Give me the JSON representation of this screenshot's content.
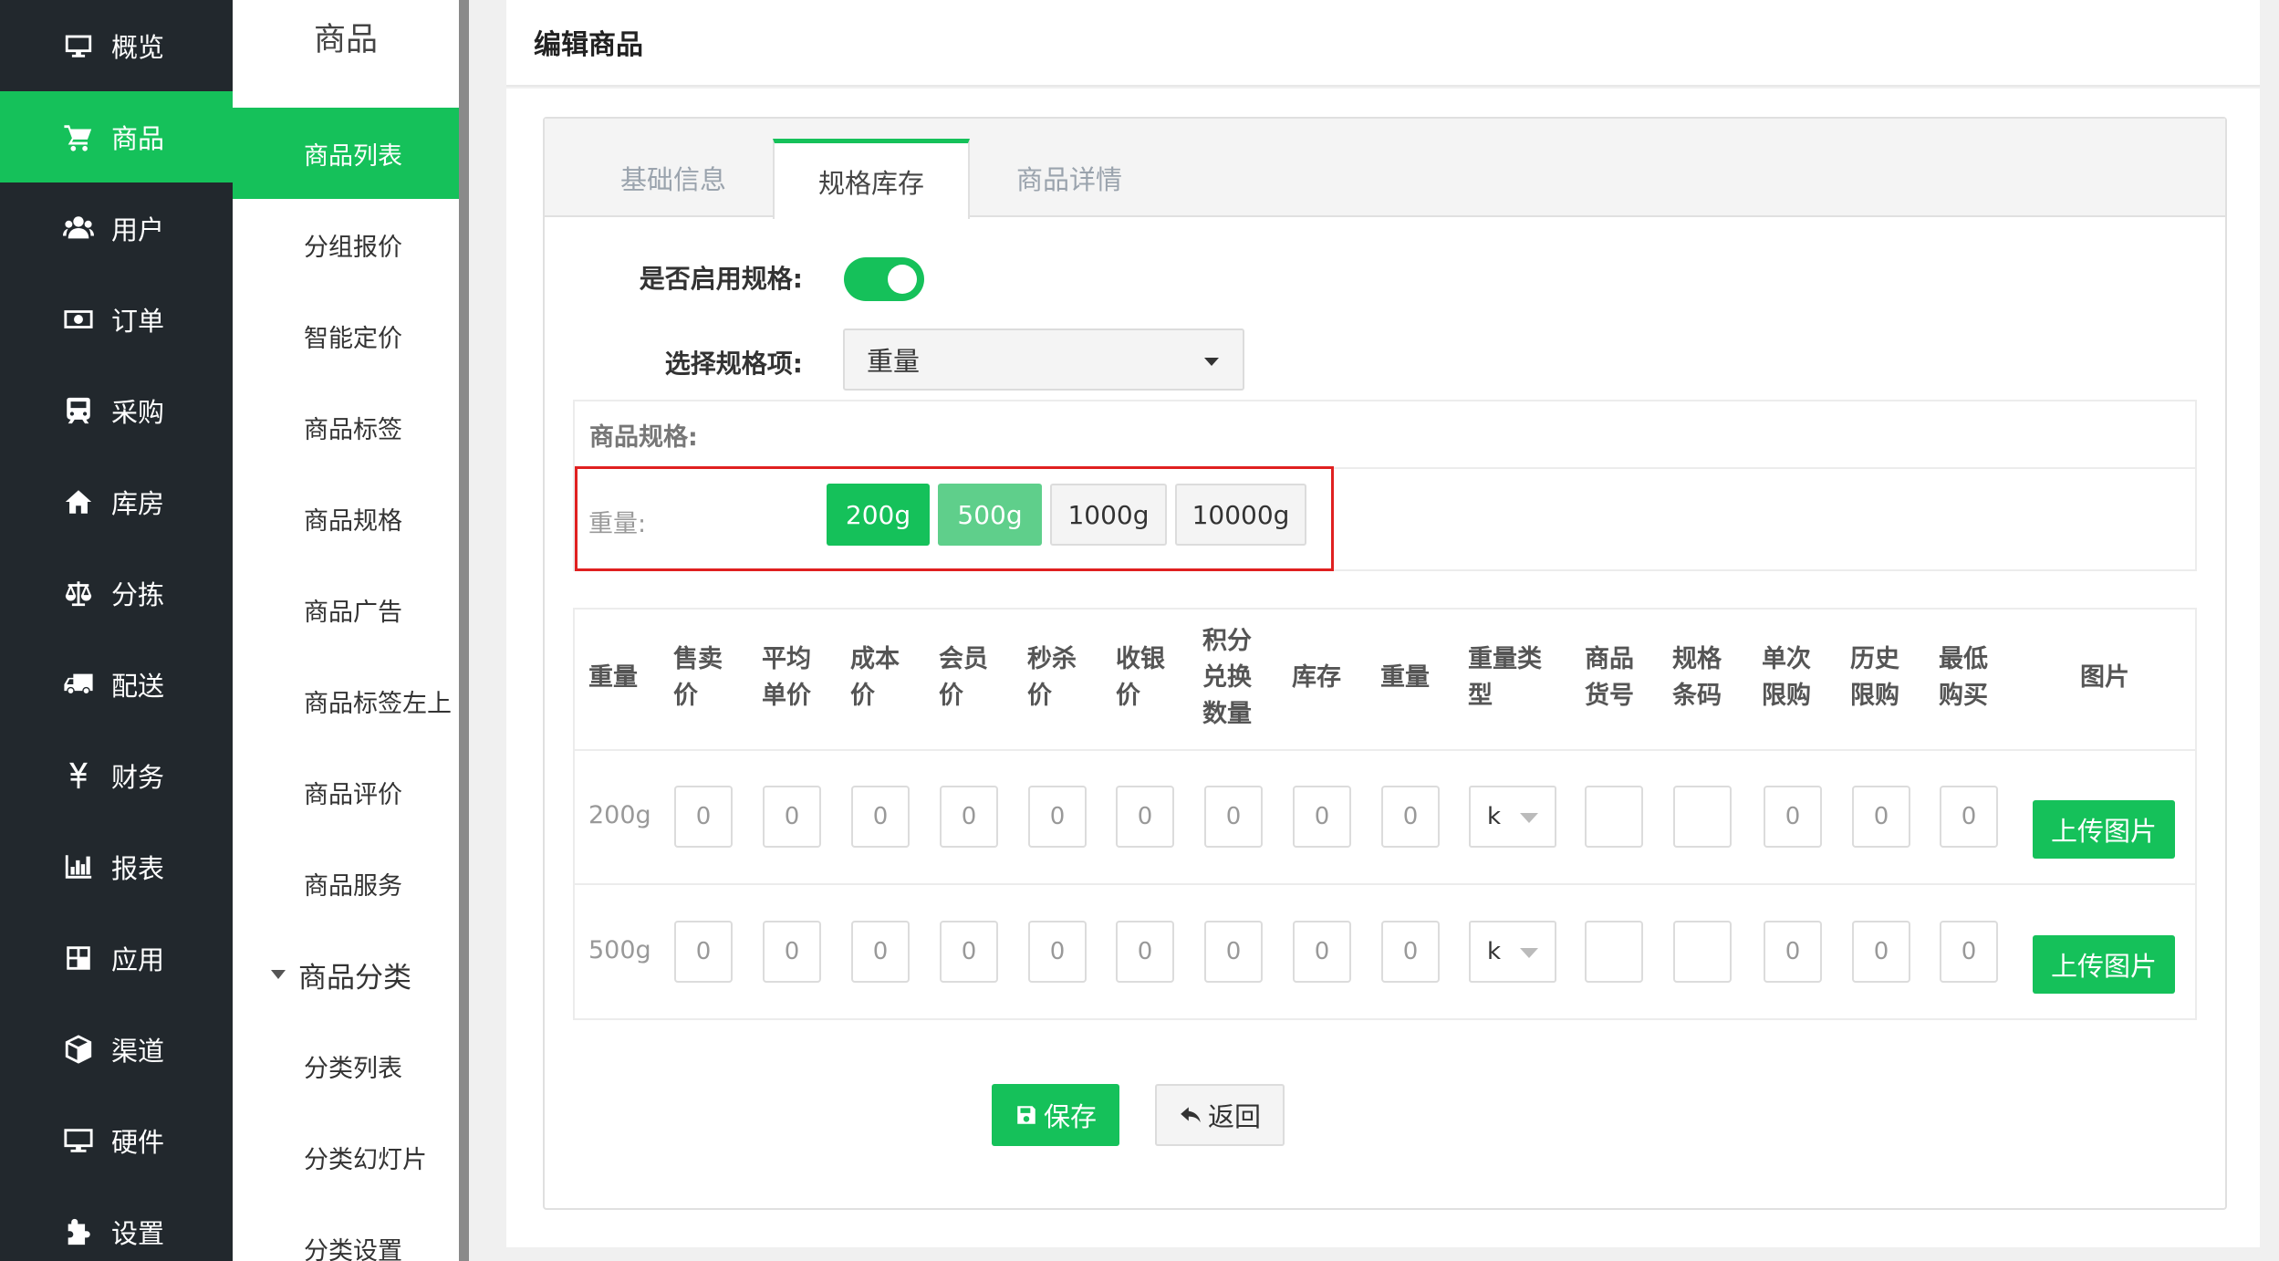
{
  "main_nav": {
    "items": [
      {
        "label": "概览",
        "icon": "monitor-icon"
      },
      {
        "label": "商品",
        "icon": "cart-icon",
        "active": true
      },
      {
        "label": "用户",
        "icon": "users-icon"
      },
      {
        "label": "订单",
        "icon": "money-icon"
      },
      {
        "label": "采购",
        "icon": "train-icon"
      },
      {
        "label": "库房",
        "icon": "home-icon"
      },
      {
        "label": "分拣",
        "icon": "balance-scale-icon"
      },
      {
        "label": "配送",
        "icon": "truck-icon"
      },
      {
        "label": "财务",
        "icon": "yen-icon"
      },
      {
        "label": "报表",
        "icon": "bar-chart-icon"
      },
      {
        "label": "应用",
        "icon": "apps-icon"
      },
      {
        "label": "渠道",
        "icon": "cube-icon"
      },
      {
        "label": "硬件",
        "icon": "desktop-icon"
      },
      {
        "label": "设置",
        "icon": "puzzle-icon"
      }
    ]
  },
  "sub_nav": {
    "title": "商品",
    "items": [
      "商品列表",
      "分组报价",
      "智能定价",
      "商品标签",
      "商品规格",
      "商品广告",
      "商品标签左上",
      "商品评价",
      "商品服务"
    ],
    "group": "商品分类",
    "group_items": [
      "分类列表",
      "分类幻灯片",
      "分类设置"
    ]
  },
  "page": {
    "title": "编辑商品"
  },
  "tabs": [
    "基础信息",
    "规格库存",
    "商品详情"
  ],
  "form": {
    "enable_spec_label": "是否启用规格:",
    "enable_spec": true,
    "select_spec_label": "选择规格项:",
    "select_spec_value": "重量",
    "spec_box_title": "商品规格:",
    "spec_row_label": "重量:",
    "spec_options": [
      {
        "label": "200g",
        "state": "selected"
      },
      {
        "label": "500g",
        "state": "selected"
      },
      {
        "label": "1000g",
        "state": "unselected"
      },
      {
        "label": "10000g",
        "state": "unselected"
      }
    ]
  },
  "sku_table": {
    "headers": [
      [
        "重量"
      ],
      [
        "售卖",
        "价"
      ],
      [
        "平均",
        "单价"
      ],
      [
        "成本",
        "价"
      ],
      [
        "会员",
        "价"
      ],
      [
        "秒杀",
        "价"
      ],
      [
        "收银",
        "价"
      ],
      [
        "积分",
        "兑换",
        "数量"
      ],
      [
        "库存"
      ],
      [
        "重量"
      ],
      [
        "重量类",
        "型"
      ],
      [
        "商品",
        "货号"
      ],
      [
        "规格",
        "条码"
      ],
      [
        "单次",
        "限购"
      ],
      [
        "历史",
        "限购"
      ],
      [
        "最低",
        "购买"
      ],
      [
        "图片"
      ]
    ],
    "rows": [
      {
        "label": "200g",
        "values": [
          "0",
          "0",
          "0",
          "0",
          "0",
          "0",
          "0",
          "0",
          "0"
        ],
        "weight_type": "k",
        "code": "",
        "barcode": "",
        "limits": [
          "0",
          "0",
          "0"
        ],
        "upload_label": "上传图片"
      },
      {
        "label": "500g",
        "values": [
          "0",
          "0",
          "0",
          "0",
          "0",
          "0",
          "0",
          "0",
          "0"
        ],
        "weight_type": "k",
        "code": "",
        "barcode": "",
        "limits": [
          "0",
          "0",
          "0"
        ],
        "upload_label": "上传图片"
      }
    ]
  },
  "actions": {
    "save_label": "保存",
    "back_label": "返回"
  },
  "colors": {
    "accent": "#15c15a",
    "sidebar": "#22282d",
    "highlight_border": "#e02020"
  }
}
